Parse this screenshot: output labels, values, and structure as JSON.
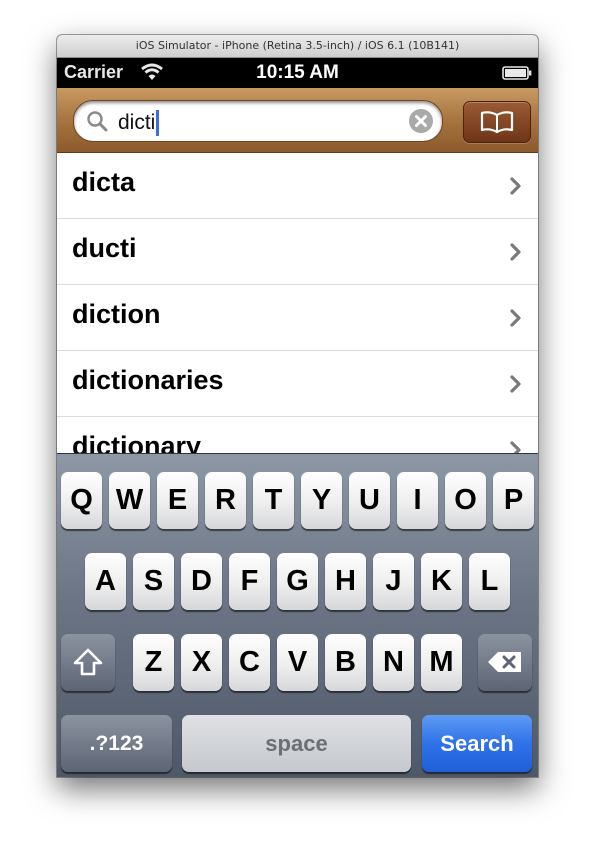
{
  "window": {
    "title": "iOS Simulator - iPhone (Retina 3.5-inch) / iOS 6.1 (10B141)"
  },
  "status_bar": {
    "carrier": "Carrier",
    "time": "10:15 AM"
  },
  "search": {
    "query": "dicti"
  },
  "results": [
    "dicta",
    "ducti",
    "diction",
    "dictionaries",
    "dictionary"
  ],
  "keyboard": {
    "row1": [
      "Q",
      "W",
      "E",
      "R",
      "T",
      "Y",
      "U",
      "I",
      "O",
      "P"
    ],
    "row2": [
      "A",
      "S",
      "D",
      "F",
      "G",
      "H",
      "J",
      "K",
      "L"
    ],
    "row3": [
      "Z",
      "X",
      "C",
      "V",
      "B",
      "N",
      "M"
    ],
    "numbers_label": ".?123",
    "space_label": "space",
    "search_label": "Search"
  },
  "colors": {
    "search_bar": "#a8743f",
    "search_key": "#2f72e8",
    "caret": "#3a6fdd"
  }
}
